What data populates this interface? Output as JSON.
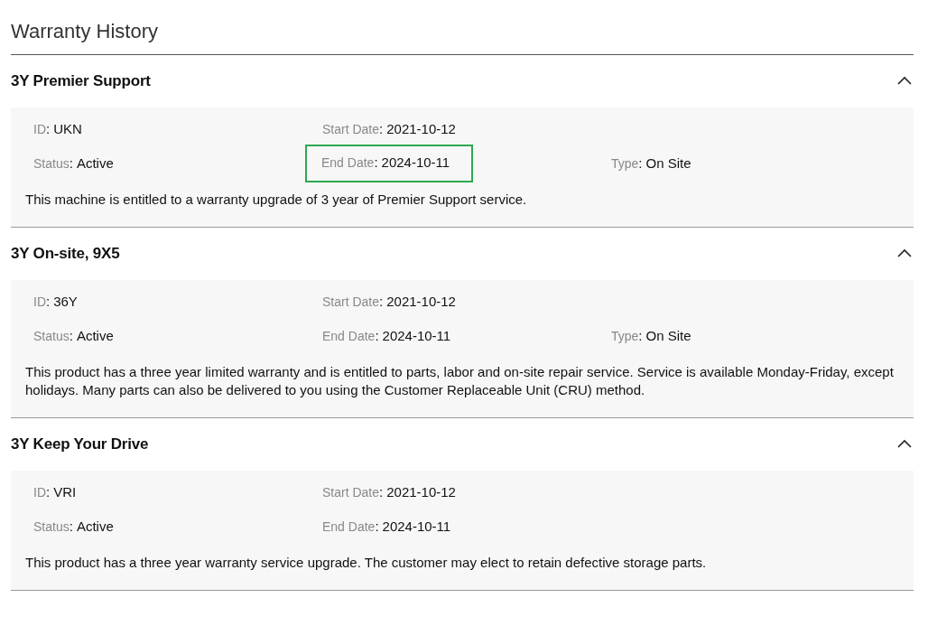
{
  "page": {
    "title": "Warranty History"
  },
  "warranties": [
    {
      "name": "3Y Premier Support",
      "expanded": true,
      "rows": [
        [
          {
            "label": "ID",
            "separator": ":",
            "value": "UKN",
            "highlighted": false
          },
          {
            "label": "Start Date",
            "separator": ":",
            "value": "2021-10-12",
            "highlighted": false
          }
        ],
        [
          {
            "label": "Status",
            "separator": ":",
            "value": "Active",
            "highlighted": false
          },
          {
            "label": "End Date",
            "separator": ":",
            "value": "2024-10-11",
            "highlighted": true
          },
          {
            "label": "Type",
            "separator": ":",
            "value": "On Site",
            "highlighted": false
          }
        ]
      ],
      "description": "This machine is entitled to a warranty upgrade of 3 year of Premier Support service."
    },
    {
      "name": "3Y On-site, 9X5",
      "expanded": true,
      "rows": [
        [
          {
            "label": "ID",
            "separator": ":",
            "value": "36Y",
            "highlighted": false
          },
          {
            "label": "Start Date",
            "separator": ":",
            "value": "2021-10-12",
            "highlighted": false
          }
        ],
        [
          {
            "label": "Status",
            "separator": ":",
            "value": "Active",
            "highlighted": false
          },
          {
            "label": "End Date",
            "separator": ":",
            "value": "2024-10-11",
            "highlighted": false
          },
          {
            "label": "Type",
            "separator": ":",
            "value": "On Site",
            "highlighted": false
          }
        ]
      ],
      "description": "This product has a three year limited warranty and is entitled to parts, labor and on-site repair service. Service is available Monday-Friday, except holidays. Many parts can also be delivered to you using the Customer Replaceable Unit (CRU) method."
    },
    {
      "name": "3Y Keep Your Drive",
      "expanded": true,
      "rows": [
        [
          {
            "label": "ID",
            "separator": ":",
            "value": "VRI",
            "highlighted": false
          },
          {
            "label": "Start Date",
            "separator": ":",
            "value": "2021-10-12",
            "highlighted": false
          }
        ],
        [
          {
            "label": "Status",
            "separator": ":",
            "value": "Active",
            "highlighted": false
          },
          {
            "label": "End Date",
            "separator": ":",
            "value": "2024-10-11",
            "highlighted": false
          }
        ]
      ],
      "description": "This product has a three year warranty service upgrade. The customer may elect to retain defective storage parts."
    }
  ]
}
